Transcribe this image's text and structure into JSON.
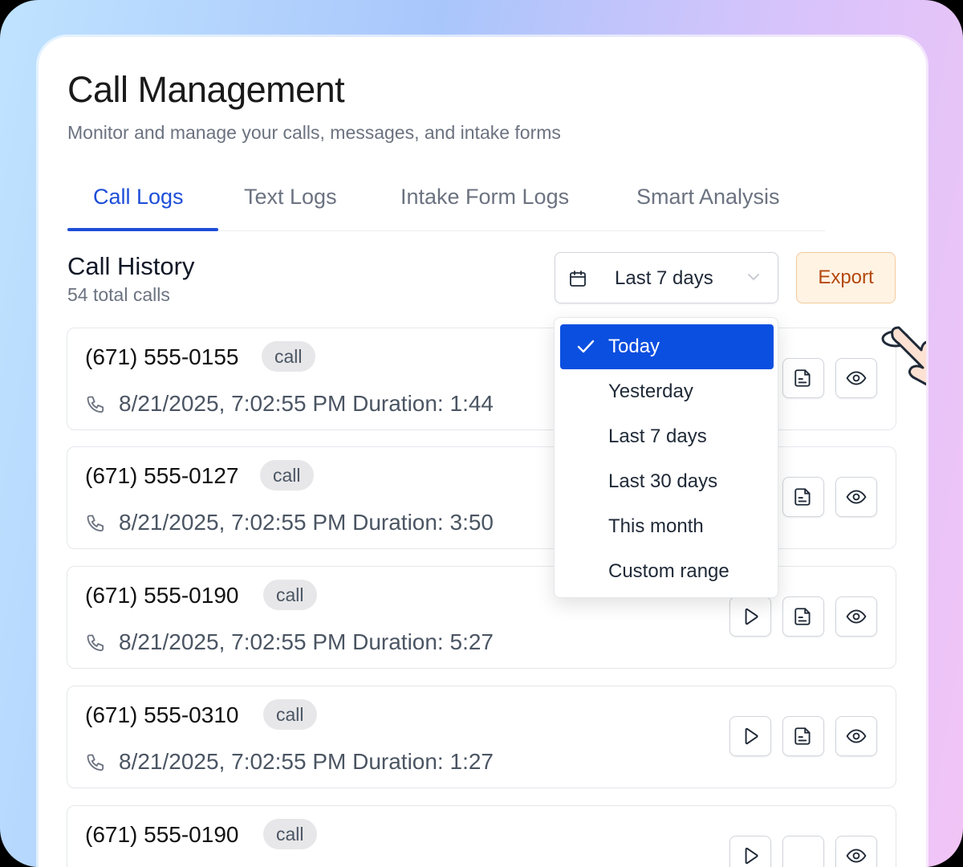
{
  "header": {
    "title": "Call Management",
    "subtitle": "Monitor and manage your calls, messages, and intake forms"
  },
  "tabs": [
    {
      "label": "Call Logs",
      "active": true
    },
    {
      "label": "Text Logs",
      "active": false
    },
    {
      "label": "Intake Form Logs",
      "active": false
    },
    {
      "label": "Smart Analysis",
      "active": false
    }
  ],
  "section": {
    "title": "Call History",
    "count": "54 total calls"
  },
  "date_filter": {
    "value": "Last 7 days",
    "icon": "calendar-icon",
    "options": [
      {
        "label": "Today",
        "selected": true
      },
      {
        "label": "Yesterday",
        "selected": false
      },
      {
        "label": "Last 7 days",
        "selected": false
      },
      {
        "label": "Last 30 days",
        "selected": false
      },
      {
        "label": "This month",
        "selected": false
      },
      {
        "label": "Custom range",
        "selected": false
      }
    ]
  },
  "export_label": "Export",
  "calls": [
    {
      "phone": "(671) 555-0155",
      "type": "call",
      "meta": "8/21/2025, 7:02:55 PM Duration: 1:44"
    },
    {
      "phone": "(671) 555-0127",
      "type": "call",
      "meta": "8/21/2025, 7:02:55 PM Duration: 3:50"
    },
    {
      "phone": "(671) 555-0190",
      "type": "call",
      "meta": "8/21/2025, 7:02:55 PM Duration: 5:27"
    },
    {
      "phone": "(671) 555-0310",
      "type": "call",
      "meta": "8/21/2025, 7:02:55 PM Duration: 1:27"
    },
    {
      "phone": "(671) 555-0190",
      "type": "call",
      "meta": ""
    }
  ],
  "colors": {
    "accent": "#1d4ed8",
    "selected_option": "#0b4fe0",
    "export_text": "#b4480e",
    "export_bg": "#fff3e4"
  }
}
